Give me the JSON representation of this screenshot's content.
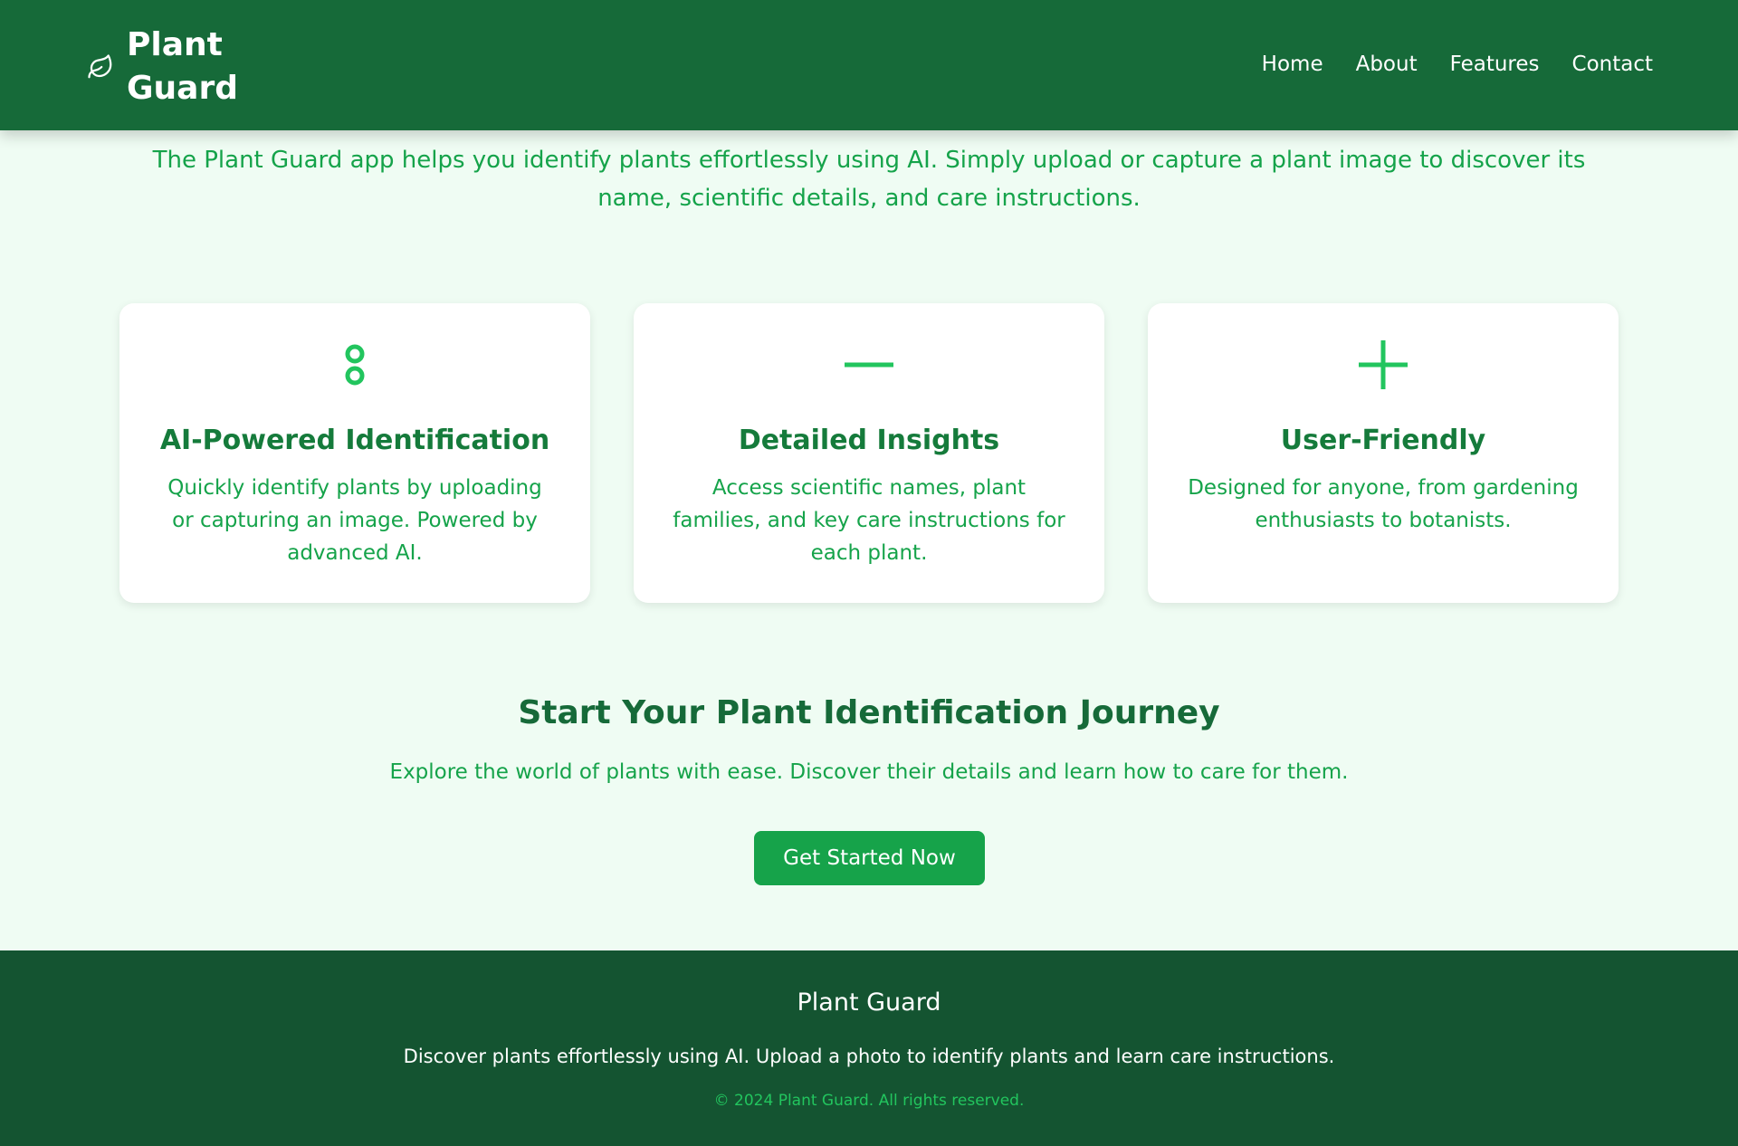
{
  "header": {
    "brand_name": "Plant Guard",
    "brand_icon": "leaf-icon",
    "nav": [
      "Home",
      "About",
      "Features",
      "Contact"
    ]
  },
  "intro": {
    "text": "The Plant Guard app helps you identify plants effortlessly using AI. Simply upload or capture a plant image to discover its name, scientific details, and care instructions."
  },
  "features": [
    {
      "icon": "two-rings-icon",
      "title": "AI-Powered Identification",
      "text": "Quickly identify plants by uploading or capturing an image. Powered by advanced AI."
    },
    {
      "icon": "minus-icon",
      "title": "Detailed Insights",
      "text": "Access scientific names, plant families, and key care instructions for each plant."
    },
    {
      "icon": "plus-icon",
      "title": "User-Friendly",
      "text": "Designed for anyone, from gardening enthusiasts to botanists."
    }
  ],
  "cta": {
    "title": "Start Your Plant Identification Journey",
    "text": "Explore the world of plants with ease. Discover their details and learn how to care for them.",
    "button_label": "Get Started Now"
  },
  "footer": {
    "title": "Plant Guard",
    "text": "Discover plants effortlessly using AI. Upload a photo to identify plants and learn care instructions.",
    "copyright": "© 2024 Plant Guard. All rights reserved."
  },
  "colors": {
    "header_bg": "#166a39",
    "page_bg": "#effcf3",
    "accent": "#16a34a",
    "icon_green": "#22c55e",
    "footer_bg": "#145431"
  }
}
